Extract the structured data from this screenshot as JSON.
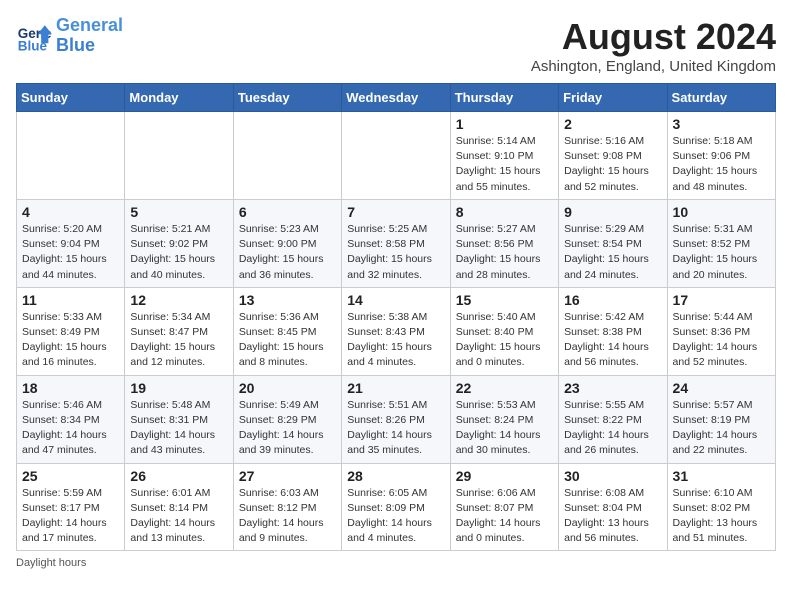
{
  "header": {
    "logo_text_general": "General",
    "logo_text_blue": "Blue",
    "month_year": "August 2024",
    "location": "Ashington, England, United Kingdom"
  },
  "weekdays": [
    "Sunday",
    "Monday",
    "Tuesday",
    "Wednesday",
    "Thursday",
    "Friday",
    "Saturday"
  ],
  "weeks": [
    [
      {
        "day": "",
        "info": ""
      },
      {
        "day": "",
        "info": ""
      },
      {
        "day": "",
        "info": ""
      },
      {
        "day": "",
        "info": ""
      },
      {
        "day": "1",
        "info": "Sunrise: 5:14 AM\nSunset: 9:10 PM\nDaylight: 15 hours\nand 55 minutes."
      },
      {
        "day": "2",
        "info": "Sunrise: 5:16 AM\nSunset: 9:08 PM\nDaylight: 15 hours\nand 52 minutes."
      },
      {
        "day": "3",
        "info": "Sunrise: 5:18 AM\nSunset: 9:06 PM\nDaylight: 15 hours\nand 48 minutes."
      }
    ],
    [
      {
        "day": "4",
        "info": "Sunrise: 5:20 AM\nSunset: 9:04 PM\nDaylight: 15 hours\nand 44 minutes."
      },
      {
        "day": "5",
        "info": "Sunrise: 5:21 AM\nSunset: 9:02 PM\nDaylight: 15 hours\nand 40 minutes."
      },
      {
        "day": "6",
        "info": "Sunrise: 5:23 AM\nSunset: 9:00 PM\nDaylight: 15 hours\nand 36 minutes."
      },
      {
        "day": "7",
        "info": "Sunrise: 5:25 AM\nSunset: 8:58 PM\nDaylight: 15 hours\nand 32 minutes."
      },
      {
        "day": "8",
        "info": "Sunrise: 5:27 AM\nSunset: 8:56 PM\nDaylight: 15 hours\nand 28 minutes."
      },
      {
        "day": "9",
        "info": "Sunrise: 5:29 AM\nSunset: 8:54 PM\nDaylight: 15 hours\nand 24 minutes."
      },
      {
        "day": "10",
        "info": "Sunrise: 5:31 AM\nSunset: 8:52 PM\nDaylight: 15 hours\nand 20 minutes."
      }
    ],
    [
      {
        "day": "11",
        "info": "Sunrise: 5:33 AM\nSunset: 8:49 PM\nDaylight: 15 hours\nand 16 minutes."
      },
      {
        "day": "12",
        "info": "Sunrise: 5:34 AM\nSunset: 8:47 PM\nDaylight: 15 hours\nand 12 minutes."
      },
      {
        "day": "13",
        "info": "Sunrise: 5:36 AM\nSunset: 8:45 PM\nDaylight: 15 hours\nand 8 minutes."
      },
      {
        "day": "14",
        "info": "Sunrise: 5:38 AM\nSunset: 8:43 PM\nDaylight: 15 hours\nand 4 minutes."
      },
      {
        "day": "15",
        "info": "Sunrise: 5:40 AM\nSunset: 8:40 PM\nDaylight: 15 hours\nand 0 minutes."
      },
      {
        "day": "16",
        "info": "Sunrise: 5:42 AM\nSunset: 8:38 PM\nDaylight: 14 hours\nand 56 minutes."
      },
      {
        "day": "17",
        "info": "Sunrise: 5:44 AM\nSunset: 8:36 PM\nDaylight: 14 hours\nand 52 minutes."
      }
    ],
    [
      {
        "day": "18",
        "info": "Sunrise: 5:46 AM\nSunset: 8:34 PM\nDaylight: 14 hours\nand 47 minutes."
      },
      {
        "day": "19",
        "info": "Sunrise: 5:48 AM\nSunset: 8:31 PM\nDaylight: 14 hours\nand 43 minutes."
      },
      {
        "day": "20",
        "info": "Sunrise: 5:49 AM\nSunset: 8:29 PM\nDaylight: 14 hours\nand 39 minutes."
      },
      {
        "day": "21",
        "info": "Sunrise: 5:51 AM\nSunset: 8:26 PM\nDaylight: 14 hours\nand 35 minutes."
      },
      {
        "day": "22",
        "info": "Sunrise: 5:53 AM\nSunset: 8:24 PM\nDaylight: 14 hours\nand 30 minutes."
      },
      {
        "day": "23",
        "info": "Sunrise: 5:55 AM\nSunset: 8:22 PM\nDaylight: 14 hours\nand 26 minutes."
      },
      {
        "day": "24",
        "info": "Sunrise: 5:57 AM\nSunset: 8:19 PM\nDaylight: 14 hours\nand 22 minutes."
      }
    ],
    [
      {
        "day": "25",
        "info": "Sunrise: 5:59 AM\nSunset: 8:17 PM\nDaylight: 14 hours\nand 17 minutes."
      },
      {
        "day": "26",
        "info": "Sunrise: 6:01 AM\nSunset: 8:14 PM\nDaylight: 14 hours\nand 13 minutes."
      },
      {
        "day": "27",
        "info": "Sunrise: 6:03 AM\nSunset: 8:12 PM\nDaylight: 14 hours\nand 9 minutes."
      },
      {
        "day": "28",
        "info": "Sunrise: 6:05 AM\nSunset: 8:09 PM\nDaylight: 14 hours\nand 4 minutes."
      },
      {
        "day": "29",
        "info": "Sunrise: 6:06 AM\nSunset: 8:07 PM\nDaylight: 14 hours\nand 0 minutes."
      },
      {
        "day": "30",
        "info": "Sunrise: 6:08 AM\nSunset: 8:04 PM\nDaylight: 13 hours\nand 56 minutes."
      },
      {
        "day": "31",
        "info": "Sunrise: 6:10 AM\nSunset: 8:02 PM\nDaylight: 13 hours\nand 51 minutes."
      }
    ]
  ],
  "footer": {
    "daylight_label": "Daylight hours"
  }
}
